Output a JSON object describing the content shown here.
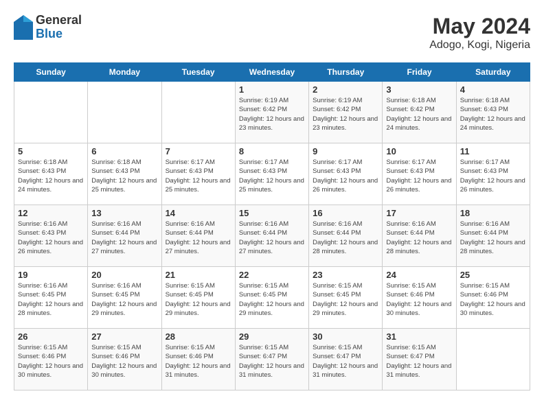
{
  "header": {
    "logo": {
      "general": "General",
      "blue": "Blue"
    },
    "title": "May 2024",
    "location": "Adogo, Kogi, Nigeria"
  },
  "days_of_week": [
    "Sunday",
    "Monday",
    "Tuesday",
    "Wednesday",
    "Thursday",
    "Friday",
    "Saturday"
  ],
  "weeks": [
    [
      {
        "day": "",
        "empty": true
      },
      {
        "day": "",
        "empty": true
      },
      {
        "day": "",
        "empty": true
      },
      {
        "day": "1",
        "sunrise": "6:19 AM",
        "sunset": "6:42 PM",
        "daylight": "12 hours and 23 minutes."
      },
      {
        "day": "2",
        "sunrise": "6:19 AM",
        "sunset": "6:42 PM",
        "daylight": "12 hours and 23 minutes."
      },
      {
        "day": "3",
        "sunrise": "6:18 AM",
        "sunset": "6:42 PM",
        "daylight": "12 hours and 24 minutes."
      },
      {
        "day": "4",
        "sunrise": "6:18 AM",
        "sunset": "6:43 PM",
        "daylight": "12 hours and 24 minutes."
      }
    ],
    [
      {
        "day": "5",
        "sunrise": "6:18 AM",
        "sunset": "6:43 PM",
        "daylight": "12 hours and 24 minutes."
      },
      {
        "day": "6",
        "sunrise": "6:18 AM",
        "sunset": "6:43 PM",
        "daylight": "12 hours and 25 minutes."
      },
      {
        "day": "7",
        "sunrise": "6:17 AM",
        "sunset": "6:43 PM",
        "daylight": "12 hours and 25 minutes."
      },
      {
        "day": "8",
        "sunrise": "6:17 AM",
        "sunset": "6:43 PM",
        "daylight": "12 hours and 25 minutes."
      },
      {
        "day": "9",
        "sunrise": "6:17 AM",
        "sunset": "6:43 PM",
        "daylight": "12 hours and 26 minutes."
      },
      {
        "day": "10",
        "sunrise": "6:17 AM",
        "sunset": "6:43 PM",
        "daylight": "12 hours and 26 minutes."
      },
      {
        "day": "11",
        "sunrise": "6:17 AM",
        "sunset": "6:43 PM",
        "daylight": "12 hours and 26 minutes."
      }
    ],
    [
      {
        "day": "12",
        "sunrise": "6:16 AM",
        "sunset": "6:43 PM",
        "daylight": "12 hours and 26 minutes."
      },
      {
        "day": "13",
        "sunrise": "6:16 AM",
        "sunset": "6:44 PM",
        "daylight": "12 hours and 27 minutes."
      },
      {
        "day": "14",
        "sunrise": "6:16 AM",
        "sunset": "6:44 PM",
        "daylight": "12 hours and 27 minutes."
      },
      {
        "day": "15",
        "sunrise": "6:16 AM",
        "sunset": "6:44 PM",
        "daylight": "12 hours and 27 minutes."
      },
      {
        "day": "16",
        "sunrise": "6:16 AM",
        "sunset": "6:44 PM",
        "daylight": "12 hours and 28 minutes."
      },
      {
        "day": "17",
        "sunrise": "6:16 AM",
        "sunset": "6:44 PM",
        "daylight": "12 hours and 28 minutes."
      },
      {
        "day": "18",
        "sunrise": "6:16 AM",
        "sunset": "6:44 PM",
        "daylight": "12 hours and 28 minutes."
      }
    ],
    [
      {
        "day": "19",
        "sunrise": "6:16 AM",
        "sunset": "6:45 PM",
        "daylight": "12 hours and 28 minutes."
      },
      {
        "day": "20",
        "sunrise": "6:16 AM",
        "sunset": "6:45 PM",
        "daylight": "12 hours and 29 minutes."
      },
      {
        "day": "21",
        "sunrise": "6:15 AM",
        "sunset": "6:45 PM",
        "daylight": "12 hours and 29 minutes."
      },
      {
        "day": "22",
        "sunrise": "6:15 AM",
        "sunset": "6:45 PM",
        "daylight": "12 hours and 29 minutes."
      },
      {
        "day": "23",
        "sunrise": "6:15 AM",
        "sunset": "6:45 PM",
        "daylight": "12 hours and 29 minutes."
      },
      {
        "day": "24",
        "sunrise": "6:15 AM",
        "sunset": "6:46 PM",
        "daylight": "12 hours and 30 minutes."
      },
      {
        "day": "25",
        "sunrise": "6:15 AM",
        "sunset": "6:46 PM",
        "daylight": "12 hours and 30 minutes."
      }
    ],
    [
      {
        "day": "26",
        "sunrise": "6:15 AM",
        "sunset": "6:46 PM",
        "daylight": "12 hours and 30 minutes."
      },
      {
        "day": "27",
        "sunrise": "6:15 AM",
        "sunset": "6:46 PM",
        "daylight": "12 hours and 30 minutes."
      },
      {
        "day": "28",
        "sunrise": "6:15 AM",
        "sunset": "6:46 PM",
        "daylight": "12 hours and 31 minutes."
      },
      {
        "day": "29",
        "sunrise": "6:15 AM",
        "sunset": "6:47 PM",
        "daylight": "12 hours and 31 minutes."
      },
      {
        "day": "30",
        "sunrise": "6:15 AM",
        "sunset": "6:47 PM",
        "daylight": "12 hours and 31 minutes."
      },
      {
        "day": "31",
        "sunrise": "6:15 AM",
        "sunset": "6:47 PM",
        "daylight": "12 hours and 31 minutes."
      },
      {
        "day": "",
        "empty": true
      }
    ]
  ]
}
